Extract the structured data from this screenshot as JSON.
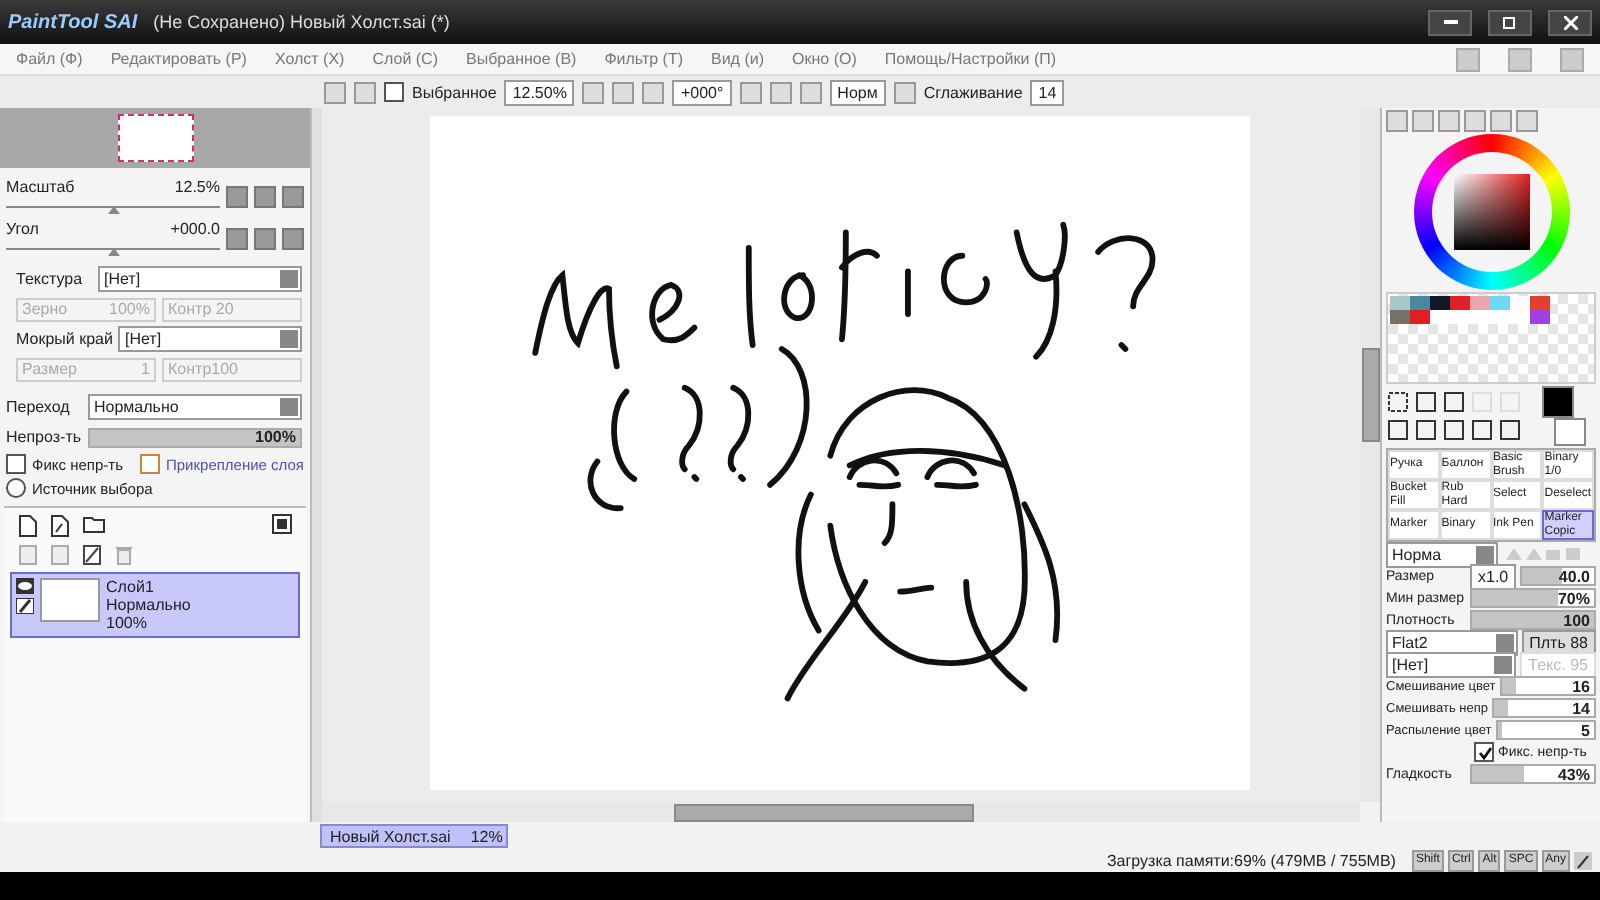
{
  "window": {
    "logo": "PaintTool SAI",
    "title": "(Не Сохранено) Новый Холст.sai (*)"
  },
  "menu": [
    "Файл (Ф)",
    "Редактировать (Р)",
    "Холст (Х)",
    "Слой (С)",
    "Выбранное (В)",
    "Фильтр (Т)",
    "Вид (и)",
    "Окно (О)",
    "Помощь/Настройки (П)"
  ],
  "toolbar": {
    "selection": {
      "label": "Выбранное",
      "checked": false
    },
    "zoom": "12.50%",
    "angle": "+000°",
    "blend": "Норм",
    "smoothing_label": "Сглаживание",
    "smoothing": "14"
  },
  "navigator": {
    "scale_label": "Масштаб",
    "scale": "12.5%",
    "scale_slider": {
      "level": 0.5
    },
    "angle_label": "Угол",
    "angle": "+000.0",
    "angle_slider": {
      "level": 0.5
    }
  },
  "layer_props": {
    "texture_label": "Текстура",
    "texture": "[Нет]",
    "grain_label": "Зерно",
    "grain": "100%",
    "contrast1": "Контр 20",
    "wet_label": "Мокрый край",
    "wet": "[Нет]",
    "size_label": "Размер",
    "size": "1",
    "contrast2": "Контр100",
    "blend_label": "Переход",
    "blend": "Нормально",
    "opacity_label": "Непроз-ть",
    "opacity": {
      "value": "100%",
      "level": 1
    },
    "checks": [
      {
        "label": "Фикс непр-ть",
        "checked": false,
        "kind": "check"
      },
      {
        "label": "Прикрепление слоя",
        "checked": false,
        "kind": "clip"
      },
      {
        "label": "Источник выбора",
        "checked": false,
        "kind": "radio"
      }
    ]
  },
  "layers": [
    {
      "name": "Слой1",
      "mode": "Нормально",
      "opacity": "100%",
      "selected": true,
      "visible": true
    }
  ],
  "palette": [
    {
      "color": "#a8c8c8"
    },
    {
      "color": "#4888a0"
    },
    {
      "color": "#101828"
    },
    {
      "color": "#e02028"
    },
    {
      "color": "#e8a8b0"
    },
    {
      "color": "#70d8f0"
    },
    {
      "color": "#ffffff"
    },
    {
      "color": "#e04030"
    },
    {
      "color": "#787068"
    },
    {
      "color": "#e02020"
    },
    {
      "color": "#ffffff"
    },
    {
      "color": "#ffffff"
    },
    {
      "color": "#ffffff"
    },
    {
      "color": "#ffffff"
    },
    {
      "color": "#ffffff"
    },
    {
      "color": "#a040e0"
    }
  ],
  "brushes": [
    {
      "name": "Ручка",
      "selected": false
    },
    {
      "name": "Баллон",
      "selected": false
    },
    {
      "name": "Basic Brush",
      "selected": false
    },
    {
      "name": "Binary 1/0",
      "selected": false
    },
    {
      "name": "Bucket Fill",
      "selected": false
    },
    {
      "name": "Rub Hard",
      "selected": false
    },
    {
      "name": "Select",
      "selected": false
    },
    {
      "name": "Deselect",
      "selected": false
    },
    {
      "name": "Marker",
      "selected": false
    },
    {
      "name": "Binary",
      "selected": false
    },
    {
      "name": "Ink Pen",
      "selected": false
    },
    {
      "name": "Marker Copic",
      "selected": true
    }
  ],
  "brush_settings": {
    "mode": "Норма",
    "size_label": "Размер",
    "size_mult": "x1.0",
    "size": {
      "value": "40.0",
      "level": 0.55
    },
    "min_size_label": "Мин размер",
    "min_size": {
      "value": "70%",
      "level": 0.7
    },
    "density_label": "Плотность",
    "density": {
      "value": "100",
      "level": 1
    },
    "shape": "Flat2",
    "shape_strength": "Плть 88",
    "texture": "[Нет]",
    "texture_strength": "Текс. 95",
    "sliders": [
      {
        "label": "Смешивание цвет",
        "value": "16",
        "level": 0.16
      },
      {
        "label": "Смешивать непр",
        "value": "14",
        "level": 0.14
      },
      {
        "label": "Распыление цвет",
        "value": "5",
        "level": 0.05
      }
    ],
    "keep_opacity": {
      "label": "Фикс. непр-ть",
      "checked": true
    },
    "smooth_label": "Гладкость",
    "smooth": {
      "value": "43%",
      "level": 0.43
    }
  },
  "document_tab": {
    "name": "Новый Холст.sai",
    "zoom": "12%",
    "selected": true
  },
  "status_bar": {
    "memory": "Загрузка памяти:69% (479MB / 755MB)",
    "keys": [
      "Shift",
      "Ctrl",
      "Alt",
      "SPC",
      "Any"
    ]
  }
}
